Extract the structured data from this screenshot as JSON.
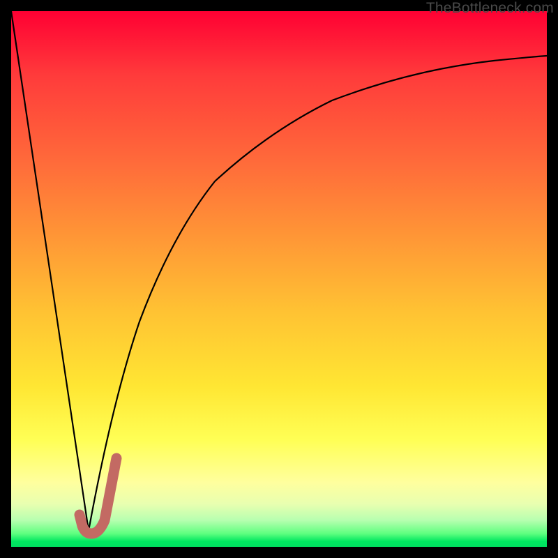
{
  "watermark": "TheBottleneck.com",
  "colors": {
    "gradient_top": "#ff0033",
    "gradient_bottom": "#00e060",
    "frame": "#000000",
    "curve": "#000000",
    "hook": "#c36a63"
  },
  "chart_data": {
    "type": "line",
    "title": "",
    "xlabel": "",
    "ylabel": "",
    "xlim": [
      0,
      100
    ],
    "ylim": [
      0,
      100
    ],
    "series": [
      {
        "name": "curve-left",
        "x": [
          0,
          14.5
        ],
        "y": [
          100,
          3
        ]
      },
      {
        "name": "curve-right",
        "x": [
          14.5,
          17,
          20,
          24,
          30,
          38,
          48,
          60,
          75,
          90,
          100
        ],
        "y": [
          3,
          15,
          28,
          42,
          56,
          68,
          77,
          83.5,
          88,
          90.5,
          91.7
        ]
      },
      {
        "name": "hook",
        "x": [
          12.8,
          13.2,
          14.0,
          15.0,
          16.2,
          17.6,
          18.8,
          19.6
        ],
        "y": [
          6.0,
          4.0,
          3.0,
          2.8,
          3.2,
          5.0,
          10.0,
          16.5
        ]
      }
    ]
  }
}
